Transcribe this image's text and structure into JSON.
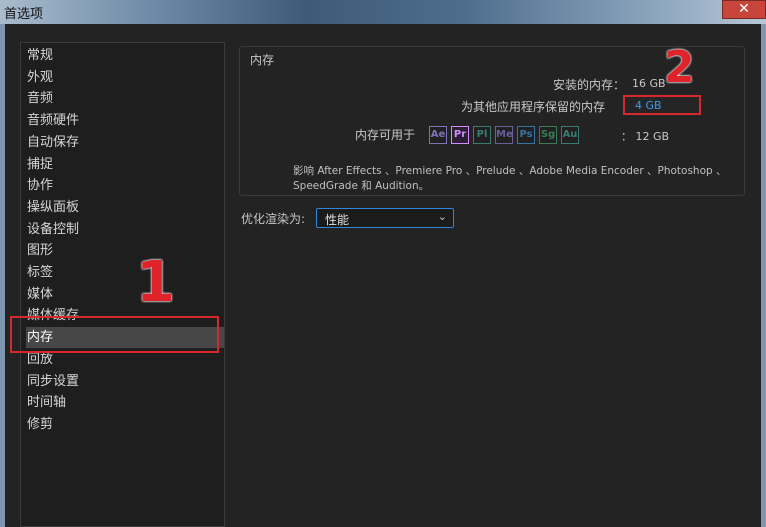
{
  "window": {
    "title": "首选项",
    "close_glyph": "✕"
  },
  "sidebar": {
    "items": [
      {
        "label": "常规"
      },
      {
        "label": "外观"
      },
      {
        "label": "音频"
      },
      {
        "label": "音频硬件"
      },
      {
        "label": "自动保存"
      },
      {
        "label": "捕捉"
      },
      {
        "label": "协作"
      },
      {
        "label": "操纵面板"
      },
      {
        "label": "设备控制"
      },
      {
        "label": "图形"
      },
      {
        "label": "标签"
      },
      {
        "label": "媒体"
      },
      {
        "label": "媒体缓存"
      },
      {
        "label": "内存"
      },
      {
        "label": "回放"
      },
      {
        "label": "同步设置"
      },
      {
        "label": "时间轴"
      },
      {
        "label": "修剪"
      }
    ],
    "selected_label": "内存"
  },
  "memory": {
    "group_title": "内存",
    "installed_label": "安装的内存：",
    "installed_value": "16 GB",
    "reserved_label": "为其他应用程序保留的内存",
    "reserved_value": "4 GB",
    "available_label": "内存可用于",
    "available_value": "：  12 GB",
    "apps": [
      {
        "abbr": "Ae",
        "color": "#9a8ff0",
        "active": false
      },
      {
        "abbr": "Pr",
        "color": "#d28cff",
        "active": true
      },
      {
        "abbr": "Pl",
        "color": "#3f9a8e",
        "active": false
      },
      {
        "abbr": "Me",
        "color": "#7f73c4",
        "active": false
      },
      {
        "abbr": "Ps",
        "color": "#3b8fcf",
        "active": false
      },
      {
        "abbr": "Sg",
        "color": "#3f9a6a",
        "active": false
      },
      {
        "abbr": "Au",
        "color": "#3f9a8e",
        "active": false
      }
    ],
    "affects_text": "影响 After Effects 、Premiere Pro 、Prelude 、Adobe Media Encoder 、Photoshop 、SpeedGrade 和 Audition。"
  },
  "optimize": {
    "label": "优化渲染为:",
    "selected": "性能"
  },
  "annotations": {
    "one": "1",
    "two": "2"
  },
  "colors": {
    "accent_red": "#d6282f",
    "link_blue": "#3d9be9",
    "focus_blue": "#2f86d8"
  }
}
